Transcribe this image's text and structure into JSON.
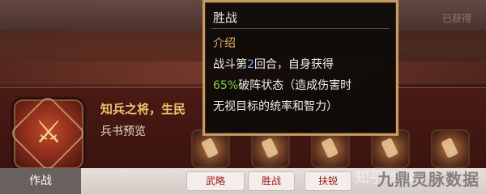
{
  "top": {
    "right_text": "已获得"
  },
  "skill": {
    "name": "知兵之将，生民",
    "sub_label": "兵书预览",
    "emblem_icon": "crossed-swords-icon"
  },
  "tooltip": {
    "title": "胜战",
    "section": "介绍",
    "lines": [
      {
        "pre": "战斗第",
        "highlight": "2",
        "post": "回合，自身获得"
      },
      {
        "pre": "",
        "highlight": "65%",
        "post": "破阵状态（造成伤害时"
      },
      {
        "pre": "无视目标的统率和智力）",
        "highlight": "",
        "post": ""
      }
    ],
    "colors": {
      "border": "#c79a62",
      "highlight_round": "#6ab3ff",
      "highlight_pct": "#7fd24a"
    }
  },
  "bottom": {
    "main_tab": "作战",
    "tabs": [
      "武略",
      "胜战",
      "扶锐"
    ],
    "watermark_left": "知乎 @星",
    "watermark_right": "九鼎灵脉数据"
  },
  "preview_icons": [
    "dagger-icon",
    "fist-icon",
    "sword-icon",
    "blade-icon",
    "shield-icon"
  ]
}
